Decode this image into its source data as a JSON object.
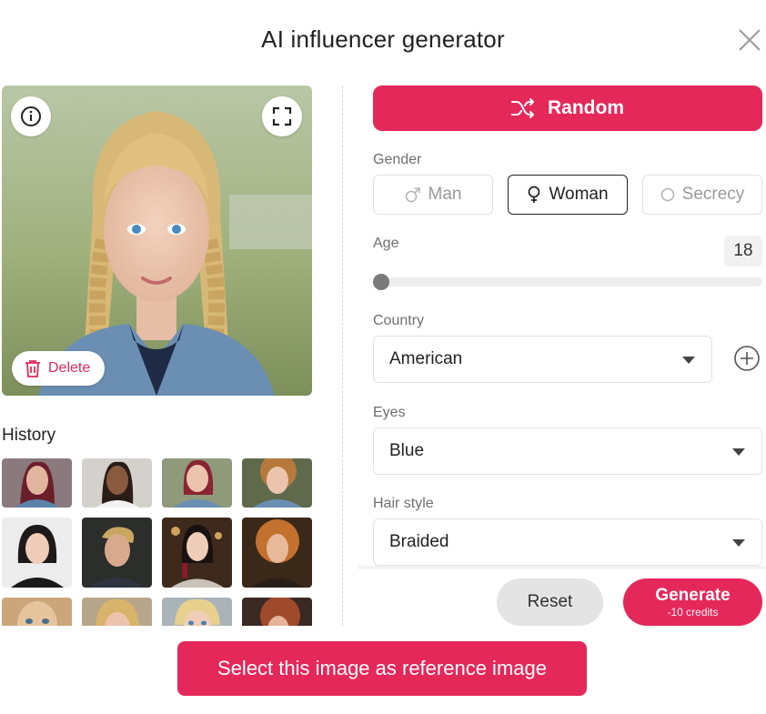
{
  "dialog": {
    "title": "AI influencer generator"
  },
  "preview": {
    "delete_label": "Delete"
  },
  "history": {
    "label": "History",
    "thumbnails": [
      {
        "name": "history-thumb-1"
      },
      {
        "name": "history-thumb-2"
      },
      {
        "name": "history-thumb-3"
      },
      {
        "name": "history-thumb-4"
      },
      {
        "name": "history-thumb-5"
      },
      {
        "name": "history-thumb-6"
      },
      {
        "name": "history-thumb-7"
      },
      {
        "name": "history-thumb-8"
      },
      {
        "name": "history-thumb-9"
      },
      {
        "name": "history-thumb-10"
      },
      {
        "name": "history-thumb-11"
      },
      {
        "name": "history-thumb-12"
      }
    ]
  },
  "form": {
    "random_label": "Random",
    "gender": {
      "label": "Gender",
      "options": [
        "Man",
        "Woman",
        "Secrecy"
      ],
      "selected": "Woman"
    },
    "age": {
      "label": "Age",
      "value": "18",
      "level": 0
    },
    "country": {
      "label": "Country",
      "value": "American"
    },
    "eyes": {
      "label": "Eyes",
      "value": "Blue"
    },
    "hair_style": {
      "label": "Hair style",
      "value": "Braided"
    }
  },
  "actions": {
    "reset_label": "Reset",
    "generate_label": "Generate",
    "generate_cost": "-10 credits",
    "select_reference_label": "Select this image as reference image"
  },
  "colors": {
    "accent": "#e5285a",
    "delete_text": "#e22a58"
  },
  "icons": [
    "close-icon",
    "info-icon",
    "fullscreen-icon",
    "trash-icon",
    "shuffle-icon",
    "male-icon",
    "female-icon",
    "circle-icon",
    "plus-circle-icon",
    "chevron-down-icon"
  ]
}
